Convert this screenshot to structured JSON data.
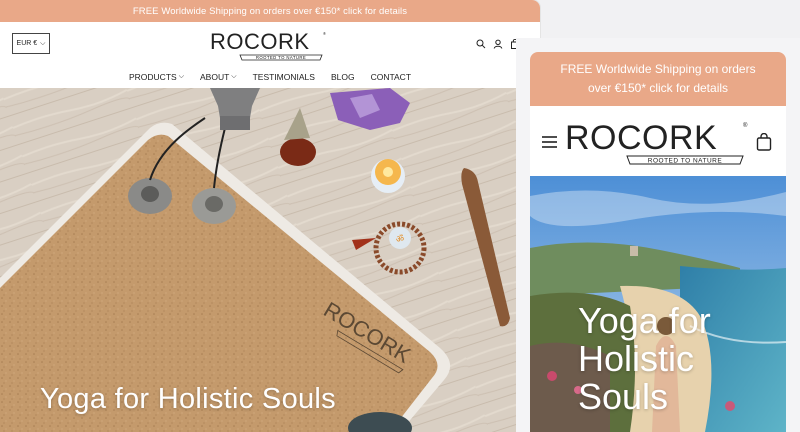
{
  "promo": {
    "text": "FREE Worldwide Shipping on orders over €150* click for details"
  },
  "brand": {
    "name": "ROCORK",
    "tagline": "ROOTED TO NATURE"
  },
  "currency": {
    "value": "EUR €"
  },
  "nav": {
    "products": "PRODUCTS",
    "about": "ABOUT",
    "testimonials": "TESTIMONIALS",
    "blog": "BLOG",
    "contact": "CONTACT"
  },
  "hero": {
    "title": "Yoga for Holistic Souls"
  },
  "mobile": {
    "promo_line1": "FREE Worldwide Shipping on orders",
    "promo_line2": "over €150* click for details",
    "hero_line1": "Yoga for",
    "hero_line2": "Holistic",
    "hero_line3": "Souls"
  },
  "colors": {
    "accent": "#e9a888",
    "text": "#222222"
  },
  "icons": [
    "search-icon",
    "account-icon",
    "cart-icon",
    "menu-icon",
    "chevron-down-icon"
  ]
}
